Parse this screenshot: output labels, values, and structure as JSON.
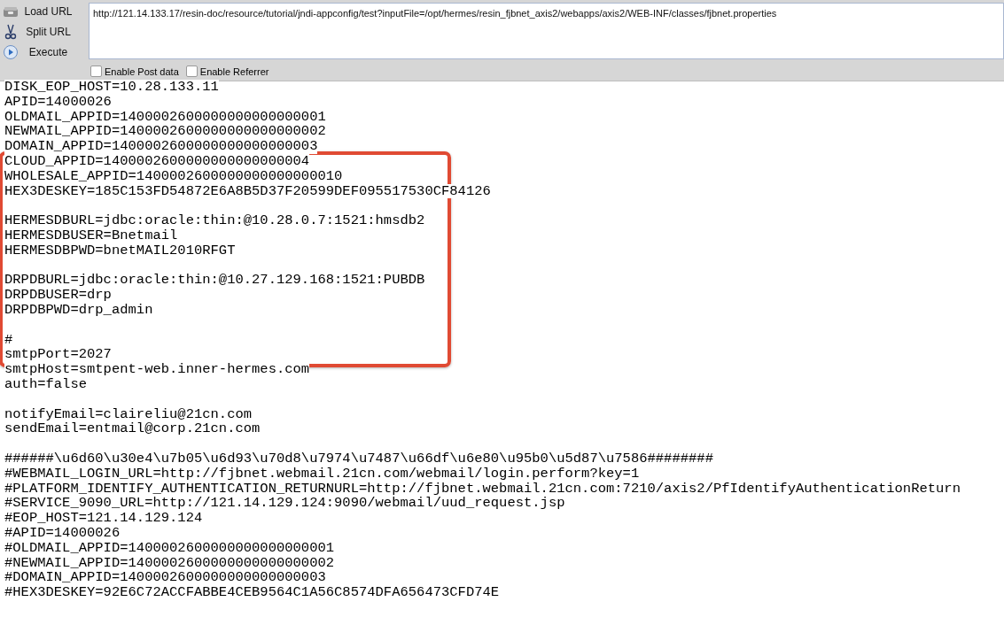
{
  "toolbar": {
    "buttons": [
      {
        "kind": "load",
        "label": "Load URL"
      },
      {
        "kind": "split",
        "label": "Split URL"
      },
      {
        "kind": "execute",
        "label": "Execute"
      }
    ],
    "url": "http://121.14.133.17/resin-doc/resource/tutorial/jndi-appconfig/test?inputFile=/opt/hermes/resin_fjbnet_axis2/webapps/axis2/WEB-INF/classes/fjbnet.properties",
    "options": [
      {
        "label": "Enable Post data",
        "checked": false
      },
      {
        "label": "Enable Referrer",
        "checked": false
      }
    ]
  },
  "content": {
    "blocks": [
      [
        "DISK_EOP_HOST=10.28.133.11",
        "APID=14000026",
        "OLDMAIL_APPID=1400002600000000000000001",
        "NEWMAIL_APPID=1400002600000000000000002",
        "DOMAIN_APPID=1400002600000000000000003",
        "CLOUD_APPID=1400002600000000000000004",
        "WHOLESALE_APPID=1400002600000000000000010",
        "HEX3DESKEY=185C153FD54872E6A8B5D37F20599DEF095517530CF84126"
      ],
      [
        "HERMESDBURL=jdbc:oracle:thin:@10.28.0.7:1521:hmsdb2",
        "HERMESDBUSER=Bnetmail",
        "HERMESDBPWD=bnetMAIL2010RFGT"
      ],
      [
        "DRPDBURL=jdbc:oracle:thin:@10.27.129.168:1521:PUBDB",
        "DRPDBUSER=drp",
        "DRPDBPWD=drp_admin"
      ],
      [
        "#",
        "smtpPort=2027",
        "smtpHost=smtpent-web.inner-hermes.com",
        "auth=false"
      ],
      [
        "notifyEmail=claireliu@21cn.com",
        "sendEmail=entmail@corp.21cn.com"
      ],
      [
        "######\\u6d60\\u30e4\\u7b05\\u6d93\\u70d8\\u7974\\u7487\\u66df\\u6e80\\u95b0\\u5d87\\u7586########",
        "#WEBMAIL_LOGIN_URL=http://fjbnet.webmail.21cn.com/webmail/login.perform?key=1",
        "#PLATFORM_IDENTIFY_AUTHENTICATION_RETURNURL=http://fjbnet.webmail.21cn.com:7210/axis2/PfIdentifyAuthenticationReturn",
        "#SERVICE_9090_URL=http://121.14.129.124:9090/webmail/uud_request.jsp",
        "#EOP_HOST=121.14.129.124",
        "#APID=14000026",
        "#OLDMAIL_APPID=1400002600000000000000001",
        "#NEWMAIL_APPID=1400002600000000000000002",
        "#DOMAIN_APPID=1400002600000000000000003",
        "#HEX3DESKEY=92E6C72ACCFABBE4CEB9564C1A56C8574DFA656473CFD74E"
      ]
    ]
  }
}
